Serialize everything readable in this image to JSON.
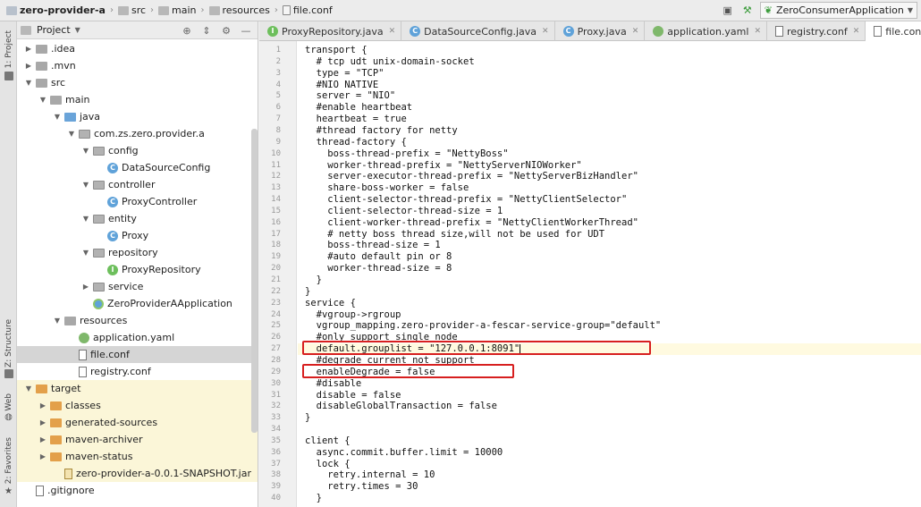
{
  "breadcrumbs": [
    "zero-provider-a",
    "src",
    "main",
    "resources",
    "file.conf"
  ],
  "run_config": "ZeroConsumerApplication",
  "tool_strip": {
    "project": "1: Project",
    "structure": "Z: Structure",
    "web": "Web",
    "favorites": "2: Favorites"
  },
  "project_panel": {
    "title": "Project",
    "tree": [
      {
        "label": ".idea",
        "indent": 1,
        "arrow": "▶",
        "icon": "fold"
      },
      {
        "label": ".mvn",
        "indent": 1,
        "arrow": "▶",
        "icon": "fold"
      },
      {
        "label": "src",
        "indent": 1,
        "arrow": "▼",
        "icon": "fold"
      },
      {
        "label": "main",
        "indent": 2,
        "arrow": "▼",
        "icon": "fold"
      },
      {
        "label": "java",
        "indent": 3,
        "arrow": "▼",
        "icon": "fold-blue"
      },
      {
        "label": "com.zs.zero.provider.a",
        "indent": 4,
        "arrow": "▼",
        "icon": "pkg"
      },
      {
        "label": "config",
        "indent": 5,
        "arrow": "▼",
        "icon": "pkg"
      },
      {
        "label": "DataSourceConfig",
        "indent": 6,
        "arrow": "",
        "icon": "cls"
      },
      {
        "label": "controller",
        "indent": 5,
        "arrow": "▼",
        "icon": "pkg"
      },
      {
        "label": "ProxyController",
        "indent": 6,
        "arrow": "",
        "icon": "cls"
      },
      {
        "label": "entity",
        "indent": 5,
        "arrow": "▼",
        "icon": "pkg"
      },
      {
        "label": "Proxy",
        "indent": 6,
        "arrow": "",
        "icon": "cls"
      },
      {
        "label": "repository",
        "indent": 5,
        "arrow": "▼",
        "icon": "pkg"
      },
      {
        "label": "ProxyRepository",
        "indent": 6,
        "arrow": "",
        "icon": "intf"
      },
      {
        "label": "service",
        "indent": 5,
        "arrow": "▶",
        "icon": "pkg"
      },
      {
        "label": "ZeroProviderAApplication",
        "indent": 5,
        "arrow": "",
        "icon": "app"
      },
      {
        "label": "resources",
        "indent": 3,
        "arrow": "▼",
        "icon": "fold"
      },
      {
        "label": "application.yaml",
        "indent": 4,
        "arrow": "",
        "icon": "yaml"
      },
      {
        "label": "file.conf",
        "indent": 4,
        "arrow": "",
        "icon": "doc",
        "selected": true
      },
      {
        "label": "registry.conf",
        "indent": 4,
        "arrow": "",
        "icon": "doc"
      },
      {
        "label": "target",
        "indent": 1,
        "arrow": "▼",
        "icon": "fold-orange",
        "target": true
      },
      {
        "label": "classes",
        "indent": 2,
        "arrow": "▶",
        "icon": "fold-orange",
        "target": true
      },
      {
        "label": "generated-sources",
        "indent": 2,
        "arrow": "▶",
        "icon": "fold-orange",
        "target": true
      },
      {
        "label": "maven-archiver",
        "indent": 2,
        "arrow": "▶",
        "icon": "fold-orange",
        "target": true
      },
      {
        "label": "maven-status",
        "indent": 2,
        "arrow": "▶",
        "icon": "fold-orange",
        "target": true
      },
      {
        "label": "zero-provider-a-0.0.1-SNAPSHOT.jar",
        "indent": 3,
        "arrow": "",
        "icon": "jar",
        "target": true
      },
      {
        "label": ".gitignore",
        "indent": 1,
        "arrow": "",
        "icon": "doc"
      }
    ]
  },
  "tabs": [
    {
      "label": "ProxyRepository.java",
      "icon": "intf"
    },
    {
      "label": "DataSourceConfig.java",
      "icon": "cls"
    },
    {
      "label": "Proxy.java",
      "icon": "cls"
    },
    {
      "label": "application.yaml",
      "icon": "yaml"
    },
    {
      "label": "registry.conf",
      "icon": "doc"
    },
    {
      "label": "file.conf",
      "icon": "doc",
      "active": true
    }
  ],
  "code_lines": [
    "transport {",
    "  # tcp udt unix-domain-socket",
    "  type = \"TCP\"",
    "  #NIO NATIVE",
    "  server = \"NIO\"",
    "  #enable heartbeat",
    "  heartbeat = true",
    "  #thread factory for netty",
    "  thread-factory {",
    "    boss-thread-prefix = \"NettyBoss\"",
    "    worker-thread-prefix = \"NettyServerNIOWorker\"",
    "    server-executor-thread-prefix = \"NettyServerBizHandler\"",
    "    share-boss-worker = false",
    "    client-selector-thread-prefix = \"NettyClientSelector\"",
    "    client-selector-thread-size = 1",
    "    client-worker-thread-prefix = \"NettyClientWorkerThread\"",
    "    # netty boss thread size,will not be used for UDT",
    "    boss-thread-size = 1",
    "    #auto default pin or 8",
    "    worker-thread-size = 8",
    "  }",
    "}",
    "service {",
    "  #vgroup->rgroup",
    "  vgroup_mapping.zero-provider-a-fescar-service-group=\"default\"",
    "  #only support single node",
    "  default.grouplist = \"127.0.0.1:8091\"",
    "  #degrade current not support",
    "  enableDegrade = false",
    "  #disable",
    "  disable = false",
    "  disableGlobalTransaction = false",
    "}",
    "",
    "client {",
    "  async.commit.buffer.limit = 10000",
    "  lock {",
    "    retry.internal = 10",
    "    retry.times = 30",
    "  }"
  ],
  "line_numbers": [
    "1",
    "2",
    "3",
    "4",
    "5",
    "6",
    "7",
    "8",
    "9",
    "10",
    "11",
    "12",
    "13",
    "14",
    "15",
    "16",
    "17",
    "18",
    "19",
    "20",
    "21",
    "22",
    "23",
    "24",
    "25",
    "26",
    "27",
    "28",
    "29",
    "30",
    "31",
    "32",
    "33",
    "34",
    "35",
    "36",
    "37",
    "38",
    "39",
    "40"
  ]
}
